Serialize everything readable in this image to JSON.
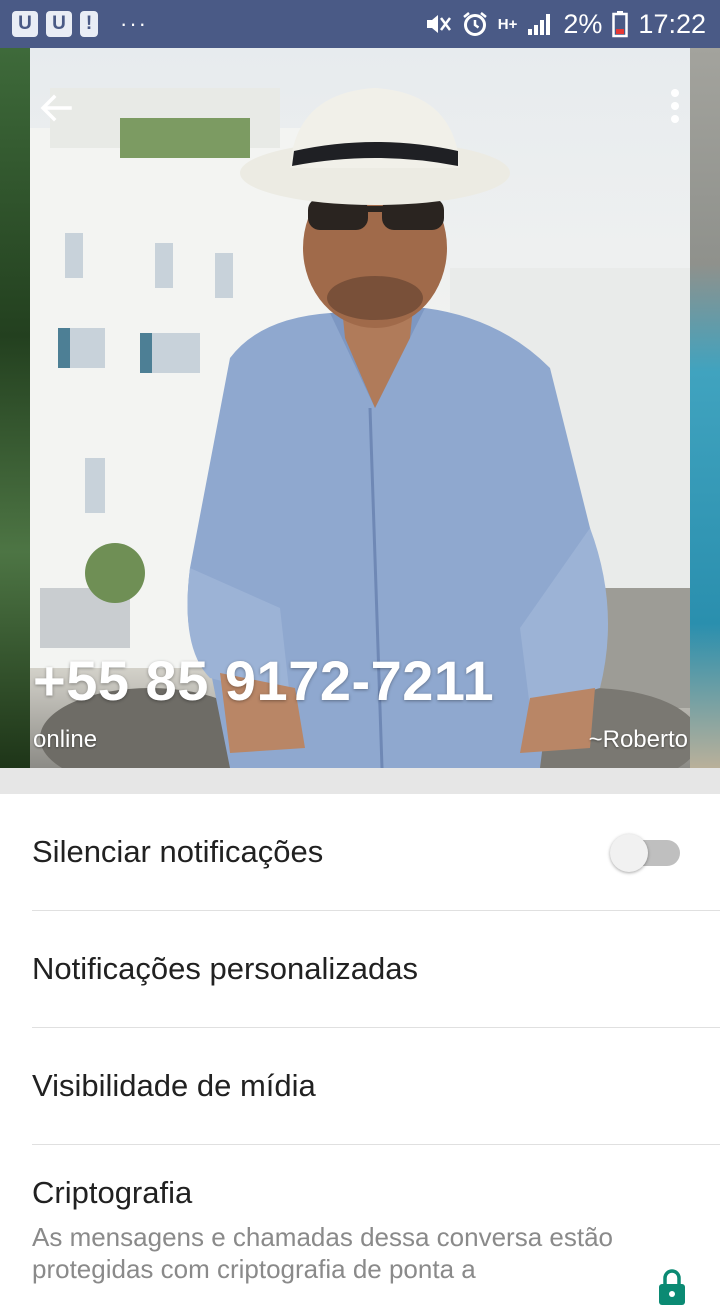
{
  "status_bar": {
    "left_badges": [
      "U",
      "U",
      "!"
    ],
    "overflow_indicator": "···",
    "network_type": "H+",
    "battery": "2%",
    "time": "17:22",
    "icons": [
      "mute-icon",
      "alarm-icon",
      "signal-icon",
      "battery-low-icon"
    ]
  },
  "header": {
    "back_icon": "arrow-left-icon",
    "menu_icon": "more-vert-icon",
    "phone_number": "+55 85 9172-7211",
    "status": "online",
    "push_name": "~Roberto"
  },
  "settings": {
    "mute_label": "Silenciar notificações",
    "mute_enabled": false,
    "custom_notifications_label": "Notificações personalizadas",
    "media_visibility_label": "Visibilidade de mídia",
    "encryption_title": "Criptografia",
    "encryption_desc": "As mensagens e chamadas dessa conversa estão protegidas com criptografia de ponta a"
  },
  "colors": {
    "status_bar": "#4a5a86",
    "lock_accent": "#0b8a73",
    "secondary_text": "#8a8a8a"
  }
}
